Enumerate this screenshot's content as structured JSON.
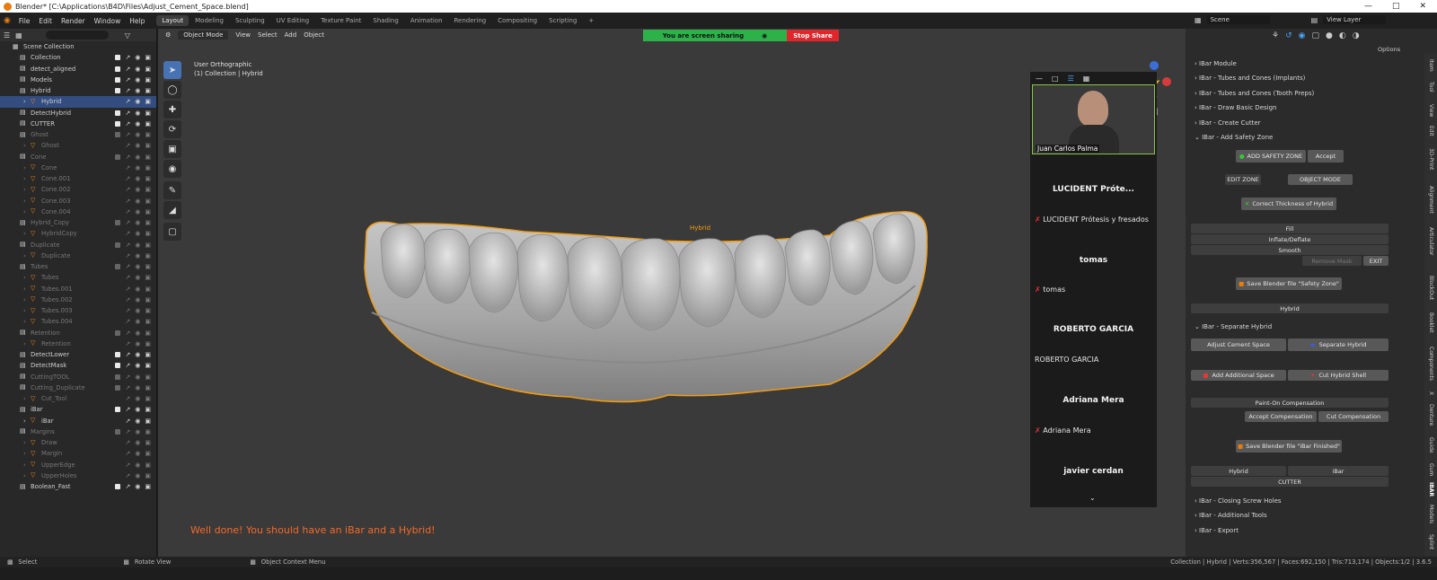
{
  "window": {
    "title": "Blender* [C:\\Applications\\B4D\\Files\\Adjust_Cement_Space.blend]"
  },
  "menu": [
    "File",
    "Edit",
    "Render",
    "Window",
    "Help"
  ],
  "workspaces": [
    "Layout",
    "Modeling",
    "Sculpting",
    "UV Editing",
    "Texture Paint",
    "Shading",
    "Animation",
    "Rendering",
    "Compositing",
    "Scripting",
    "+"
  ],
  "scene": {
    "scene_name": "Scene",
    "view_layer": "View Layer"
  },
  "outliner": {
    "root": "Scene Collection",
    "rows": [
      {
        "label": "Collection",
        "depth": 1,
        "type": "coll"
      },
      {
        "label": "detect_aligned",
        "depth": 1,
        "type": "coll"
      },
      {
        "label": "Models",
        "depth": 1,
        "type": "coll"
      },
      {
        "label": "Hybrid",
        "depth": 1,
        "type": "coll"
      },
      {
        "label": "Hybrid",
        "depth": 2,
        "type": "obj",
        "sel": true
      },
      {
        "label": "DetectHybrid",
        "depth": 1,
        "type": "coll"
      },
      {
        "label": "CUTTER",
        "depth": 1,
        "type": "coll"
      },
      {
        "label": "Ghost",
        "depth": 1,
        "type": "coll",
        "dim": true
      },
      {
        "label": "Ghost",
        "depth": 2,
        "type": "obj",
        "dim": true
      },
      {
        "label": "Cone",
        "depth": 1,
        "type": "coll",
        "dim": true
      },
      {
        "label": "Cone",
        "depth": 2,
        "type": "obj",
        "dim": true
      },
      {
        "label": "Cone.001",
        "depth": 2,
        "type": "obj",
        "dim": true
      },
      {
        "label": "Cone.002",
        "depth": 2,
        "type": "obj",
        "dim": true
      },
      {
        "label": "Cone.003",
        "depth": 2,
        "type": "obj",
        "dim": true
      },
      {
        "label": "Cone.004",
        "depth": 2,
        "type": "obj",
        "dim": true
      },
      {
        "label": "Hybrid_Copy",
        "depth": 1,
        "type": "coll",
        "dim": true
      },
      {
        "label": "HybridCopy",
        "depth": 2,
        "type": "obj",
        "dim": true
      },
      {
        "label": "Duplicate",
        "depth": 1,
        "type": "coll",
        "dim": true
      },
      {
        "label": "Duplicate",
        "depth": 2,
        "type": "obj",
        "dim": true
      },
      {
        "label": "Tubes",
        "depth": 1,
        "type": "coll",
        "dim": true
      },
      {
        "label": "Tubes",
        "depth": 2,
        "type": "obj",
        "dim": true
      },
      {
        "label": "Tubes.001",
        "depth": 2,
        "type": "obj",
        "dim": true
      },
      {
        "label": "Tubes.002",
        "depth": 2,
        "type": "obj",
        "dim": true
      },
      {
        "label": "Tubes.003",
        "depth": 2,
        "type": "obj",
        "dim": true
      },
      {
        "label": "Tubes.004",
        "depth": 2,
        "type": "obj",
        "dim": true
      },
      {
        "label": "Retention",
        "depth": 1,
        "type": "coll",
        "dim": true
      },
      {
        "label": "Retention",
        "depth": 2,
        "type": "obj",
        "dim": true
      },
      {
        "label": "DetectLower",
        "depth": 1,
        "type": "coll"
      },
      {
        "label": "DetectMask",
        "depth": 1,
        "type": "coll"
      },
      {
        "label": "CuttingTOOL",
        "depth": 1,
        "type": "coll",
        "dim": true
      },
      {
        "label": "Cutting_Duplicate",
        "depth": 1,
        "type": "coll",
        "dim": true
      },
      {
        "label": "Cut_Tool",
        "depth": 2,
        "type": "obj",
        "dim": true
      },
      {
        "label": "iBar",
        "depth": 1,
        "type": "coll"
      },
      {
        "label": "iBar",
        "depth": 2,
        "type": "obj"
      },
      {
        "label": "Margins",
        "depth": 1,
        "type": "coll",
        "dim": true
      },
      {
        "label": "Draw",
        "depth": 2,
        "type": "obj",
        "dim": true
      },
      {
        "label": "Margin",
        "depth": 2,
        "type": "obj",
        "dim": true
      },
      {
        "label": "UpperEdge",
        "depth": 2,
        "type": "obj",
        "dim": true
      },
      {
        "label": "UpperHoles",
        "depth": 2,
        "type": "obj",
        "dim": true
      },
      {
        "label": "Boolean_Fast",
        "depth": 1,
        "type": "coll"
      }
    ]
  },
  "viewport": {
    "header": [
      "Object Mode",
      "View",
      "Select",
      "Add",
      "Object"
    ],
    "view_name": "User Orthographic",
    "collection_label": "(1) Collection | Hybrid",
    "object_label": "Hybrid",
    "message": "Well done! You should have an iBar and a Hybrid!"
  },
  "screenshare": {
    "text": "You are screen sharing",
    "stop": "Stop Share"
  },
  "video_panel": {
    "presenter": "Juan Carlos Palma",
    "participants": [
      {
        "name": "LUCIDENT  Próte...",
        "sub": "LUCIDENT Prótesis y fresados"
      },
      {
        "name": "tomas",
        "sub": "tomas"
      },
      {
        "name": "ROBERTO GARCIA",
        "sub": "ROBERTO GARCIA"
      },
      {
        "name": "Adriana Mera",
        "sub": "Adriana Mera"
      },
      {
        "name": "javier cerdan",
        "sub": ""
      }
    ]
  },
  "npanel": {
    "options": "Options",
    "headers": {
      "module": "IBar Module",
      "tubes_implants": "IBar - Tubes and Cones (Implants)",
      "tubes_tooth": "IBar - Tubes and Cones (Tooth Preps)",
      "draw_basic": "IBar - Draw Basic Design",
      "create_cutter": "IBar - Create Cutter",
      "add_safety": "IBar - Add Safety Zone",
      "separate": "IBar - Separate Hybrid",
      "closing": "IBar - Closing Screw Holes",
      "additional": "IBar - Additional Tools",
      "export": "IBar - Export"
    },
    "buttons": {
      "add_safety": "ADD SAFETY ZONE",
      "accept": "Accept",
      "edit_zone": "EDIT ZONE",
      "object_mode": "OBJECT MODE",
      "correct_thickness": "Correct Thickness of Hybrid",
      "fill": "Fill",
      "inflate": "Inflate/Deflate",
      "smooth": "Smooth",
      "remove_mask": "Remove Mask",
      "exit": "EXIT",
      "save_safety": "Save Blender file \"Safety Zone\"",
      "hybrid": "Hybrid",
      "adjust_cement": "Adjust Cement Space",
      "separate_hybrid": "Separate Hybrid",
      "add_additional": "Add Additional Space",
      "cut_shell": "Cut Hybrid Shell",
      "paint_on": "Paint-On Compensation",
      "accept_comp": "Accept Compensation",
      "cut_comp": "Cut Compensation",
      "save_ibar": "Save Blender file \"iBar Finished\"",
      "hybrid2": "Hybrid",
      "ibar": "iBar",
      "cutter": "CUTTER"
    },
    "tabs": [
      "Item",
      "Tool",
      "View",
      "Edit",
      "3D-Print",
      "Alignment",
      "Articulator",
      "BlockOut",
      "Booklet",
      "Components",
      "X",
      "Denture",
      "Guide",
      "Gum",
      "IBAR",
      "Models",
      "Splint"
    ]
  },
  "status": {
    "select": "Select",
    "rotate": "Rotate View",
    "context": "Object Context Menu",
    "stats": "Collection | Hybrid | Verts:356,567 | Faces:692,150 | Tris:713,174 | Objects:1/2 | 3.6.5"
  }
}
